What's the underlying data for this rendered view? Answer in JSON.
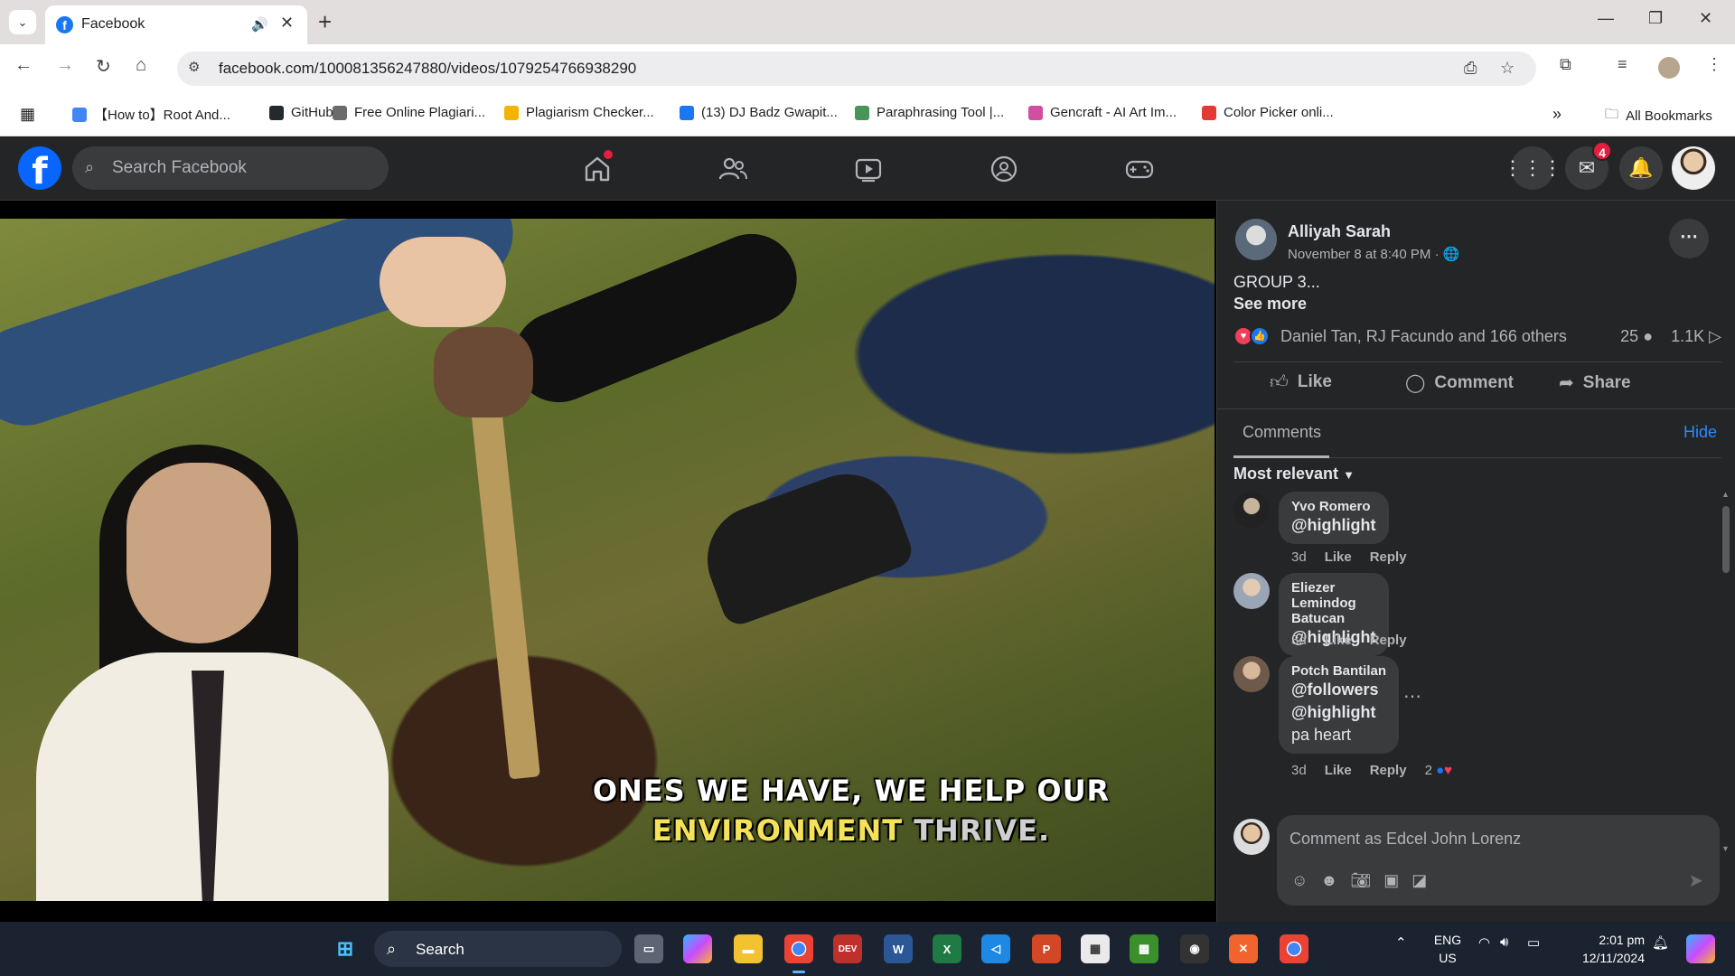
{
  "browser": {
    "tab_title": "Facebook",
    "url": "facebook.com/100081356247880/videos/1079254766938290",
    "bookmarks": [
      {
        "label": "【How to】Root And...",
        "icon": "google-icon",
        "color": "#4285f4"
      },
      {
        "label": "GitHub",
        "icon": "github-icon",
        "color": "#24292e"
      },
      {
        "label": "Free Online Plagiari...",
        "icon": "doc-icon",
        "color": "#6b6b6b"
      },
      {
        "label": "Plagiarism Checker...",
        "icon": "p-icon",
        "color": "#f2b400"
      },
      {
        "label": "(13) DJ Badz Gwapit...",
        "icon": "facebook-icon",
        "color": "#1877f2"
      },
      {
        "label": "Paraphrasing Tool |...",
        "icon": "quillbot-icon",
        "color": "#499557"
      },
      {
        "label": "Gencraft - AI Art Im...",
        "icon": "gencraft-icon",
        "color": "#d04fa0"
      },
      {
        "label": "Color Picker onli...",
        "icon": "color-picker-icon",
        "color": "#e53935"
      }
    ],
    "all_bookmarks": "All Bookmarks"
  },
  "fb": {
    "search_placeholder": "Search Facebook",
    "messenger_badge": "4"
  },
  "video": {
    "caption_line1": "ONES WE HAVE, WE HELP OUR",
    "caption_line2_a": "ENVIRONMENT",
    "caption_line2_b": "THRIVE."
  },
  "post": {
    "author": "Alliyah Sarah",
    "time": "November 8 at 8:40 PM · ",
    "text": "GROUP 3...",
    "see_more": "See more",
    "reactions_names": "Daniel Tan, RJ Facundo and 166 others",
    "comments_count": "25",
    "shares_count": "1.1K",
    "like": "Like",
    "comment": "Comment",
    "share": "Share"
  },
  "comments_section": {
    "tab": "Comments",
    "hide": "Hide",
    "sort": "Most relevant",
    "items": [
      {
        "name": "Yvo Romero",
        "text": [
          "@highlight"
        ],
        "age": "3d",
        "like": "Like",
        "reply": "Reply"
      },
      {
        "name": "Eliezer Lemindog Batucan",
        "text": [
          "@highlight"
        ],
        "age": "3d",
        "like": "Like",
        "reply": "Reply"
      },
      {
        "name": "Potch Bantilan",
        "text": [
          "@followers",
          "@highlight",
          "pa heart"
        ],
        "age": "3d",
        "like": "Like",
        "reply": "Reply",
        "reaction_count": "2"
      }
    ],
    "composer_placeholder": "Comment as Edcel John Lorenz"
  },
  "taskbar": {
    "search": "Search",
    "lang1": "ENG",
    "lang2": "US",
    "time": "2:01 pm",
    "date": "12/11/2024"
  },
  "colors": {
    "fb_blue": "#0866ff",
    "link_blue": "#2d88ff",
    "badge_red": "#e41e3f"
  }
}
